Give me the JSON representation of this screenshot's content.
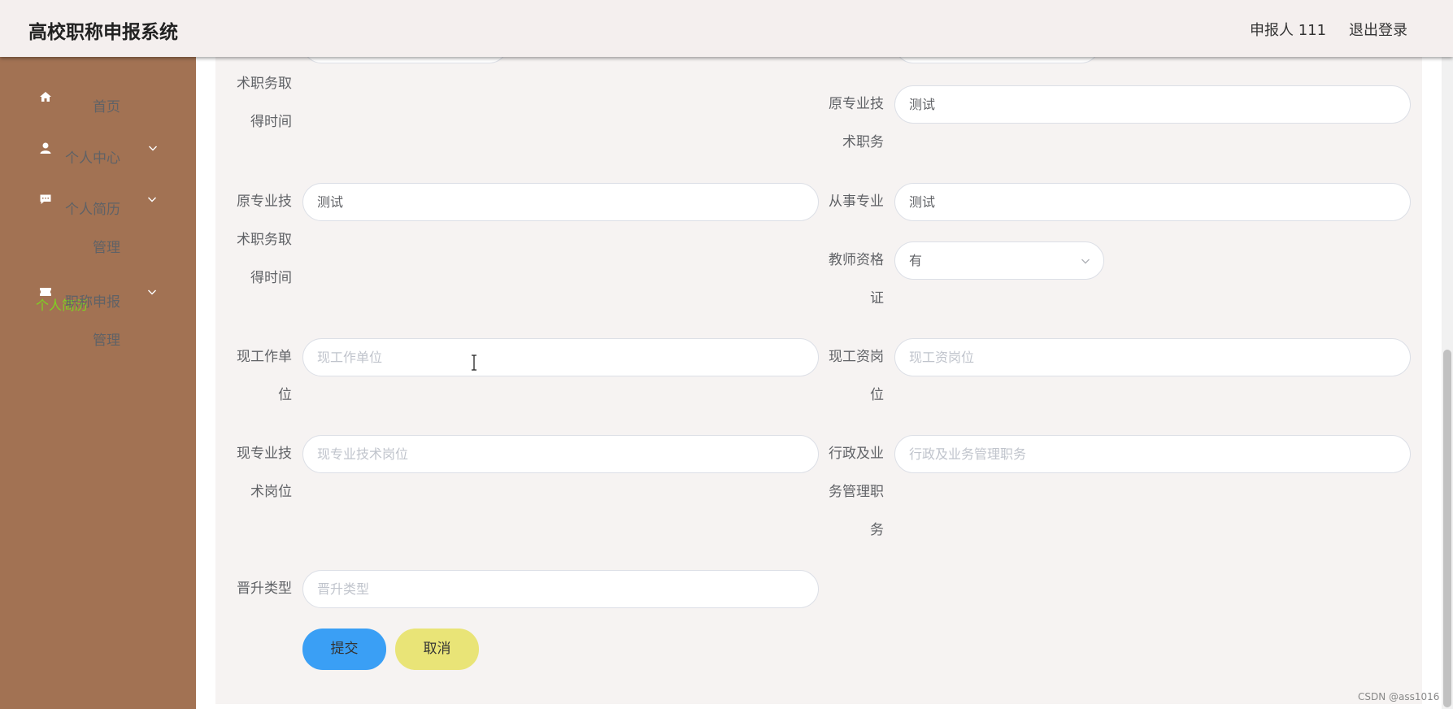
{
  "header": {
    "title": "高校职称申报系统",
    "user_label": "申报人 111",
    "logout_label": "退出登录"
  },
  "sidebar": {
    "items": [
      {
        "label": "首页",
        "icon": "home-icon"
      },
      {
        "label": "个人中心",
        "icon": "user-icon"
      },
      {
        "label": "个人简历管理",
        "icon": "comment-icon"
      },
      {
        "label": "职称申报管理",
        "icon": "ticket-icon"
      }
    ],
    "active_subitem": "个人简历"
  },
  "form": {
    "rows": {
      "r1_left_label": "术职务取得时间",
      "r1_right_label": "原专业技术职务",
      "r1_right_value": "测试",
      "r2_left_label": "原专业技术职务取得时间",
      "r2_left_value": "测试",
      "r2_right_label": "从事专业",
      "r2_right_value": "测试",
      "r3_right_label": "教师资格证",
      "r3_right_value": "有",
      "r4_left_label": "现工作单位",
      "r4_left_placeholder": "现工作单位",
      "r4_right_label": "现工资岗位",
      "r4_right_placeholder": "现工资岗位",
      "r5_left_label": "现专业技术岗位",
      "r5_left_placeholder": "现专业技术岗位",
      "r5_right_label": "行政及业务管理职务",
      "r5_right_placeholder": "行政及业务管理职务",
      "r6_left_label": "晋升类型",
      "r6_left_placeholder": "晋升类型"
    },
    "submit_label": "提交",
    "cancel_label": "取消"
  },
  "watermark": "CSDN @ass1016",
  "colors": {
    "sidebar_bg": "#a27253",
    "header_bg": "#f4efee",
    "content_bg": "#f6f3f2",
    "submit_bg": "#3a9ff5",
    "cancel_bg": "#e9e477",
    "active_menu": "#7ed321"
  }
}
